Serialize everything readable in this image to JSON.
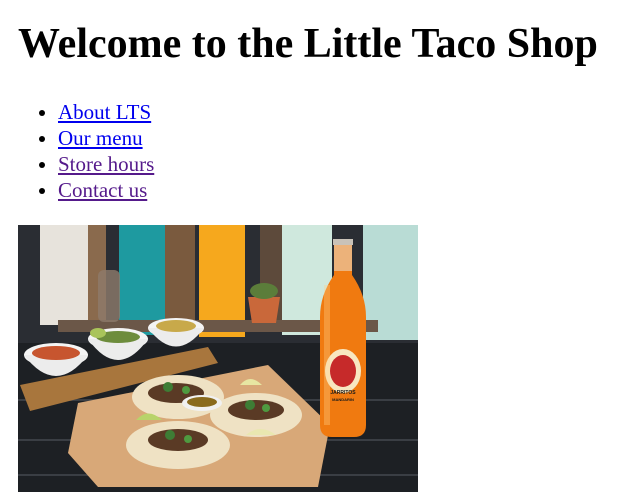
{
  "page": {
    "heading": "Welcome to the Little Taco Shop"
  },
  "nav": {
    "items": [
      {
        "label": "About LTS",
        "visited": false
      },
      {
        "label": "Our menu",
        "visited": false
      },
      {
        "label": "Store hours",
        "visited": true
      },
      {
        "label": "Contact us",
        "visited": true
      }
    ]
  },
  "colors": {
    "link": "#0000ee",
    "visited_link": "#551a8b"
  },
  "image": {
    "subject": "tacos-and-soda-photo",
    "bottle_label_text": "JARRITOS",
    "bottle_flavor_text": "MANDARIN"
  }
}
